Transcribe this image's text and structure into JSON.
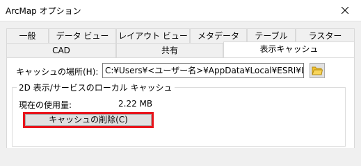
{
  "window": {
    "title": "ArcMap オプション",
    "close_icon": "close-icon"
  },
  "tabs": {
    "row_back": [
      "一般",
      "データ ビュー",
      "レイアウト ビュー",
      "メタデータ",
      "テーブル",
      "ラスター"
    ],
    "row_front": [
      "CAD",
      "共有",
      "表示キャッシュ"
    ],
    "active": "表示キャッシュ"
  },
  "cache": {
    "location_label": "キャッシュの場所(H):",
    "location_value": "C:¥Users¥<ユーザー名>¥AppData¥Local¥ESRI¥Local Caches",
    "browse_icon": "folder-icon",
    "group_title": "2D 表示/サービスのローカル キャッシュ",
    "usage_label": "現在の使用量:",
    "usage_value": "2.22 MB",
    "delete_button": "キャッシュの削除(C)"
  },
  "colors": {
    "highlight": "#e8141b",
    "window_bg": "#f0f0f0",
    "panel_bg": "#ffffff"
  }
}
